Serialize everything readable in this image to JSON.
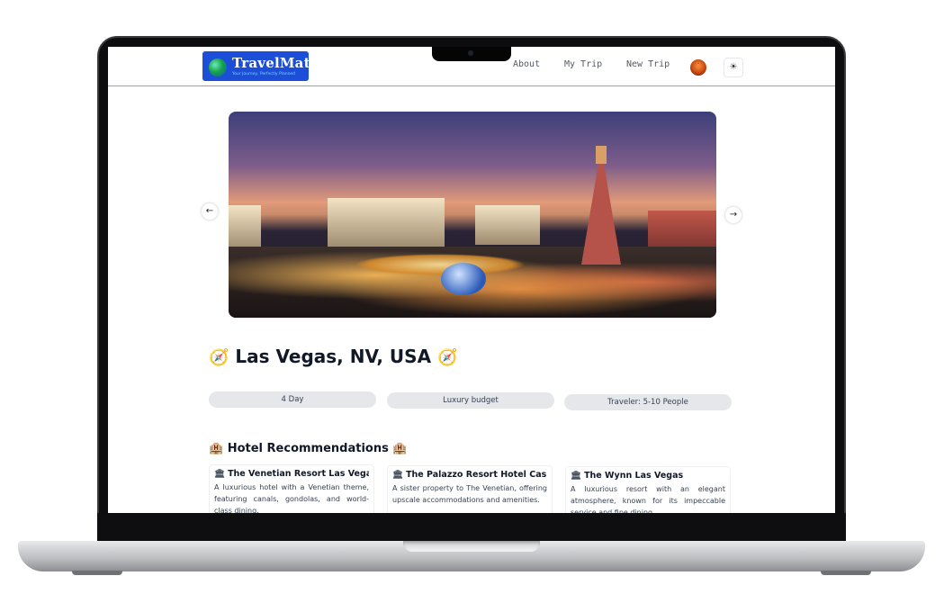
{
  "app": {
    "logo_title": "TravelMate",
    "logo_tagline": "Your Journey, Perfectly Planned"
  },
  "nav": {
    "about": "About",
    "my_trip": "My Trip",
    "new_trip": "New Trip",
    "theme_icon": "sun-icon"
  },
  "carousel": {
    "prev_label": "←",
    "next_label": "→"
  },
  "destination": {
    "compass_left": "🧭",
    "name": "Las Vegas, NV, USA",
    "compass_right": "🧭"
  },
  "trip_info": {
    "days": "4 Day",
    "budget": "Luxury budget",
    "travelers": "Traveler: 5-10 People"
  },
  "hotels": {
    "title": "🏨 Hotel Recommendations 🏨",
    "items": [
      {
        "icon": "🏛",
        "name": "The Venetian Resort Las Vegas",
        "description": "A luxurious hotel with a Venetian theme, featuring canals, gondolas, and world-class dining."
      },
      {
        "icon": "🏛",
        "name": "The Palazzo Resort Hotel Casino",
        "description": "A sister property to The Venetian, offering upscale accommodations and amenities."
      },
      {
        "icon": "🏛",
        "name": "The Wynn Las Vegas",
        "description": "A luxurious resort with an elegant atmosphere, known for its impeccable service and fine dining."
      }
    ]
  },
  "colors": {
    "logo_bg": "#1d4ed8",
    "pill_bg": "#e5e7eb",
    "compass": "#f59e0b"
  }
}
